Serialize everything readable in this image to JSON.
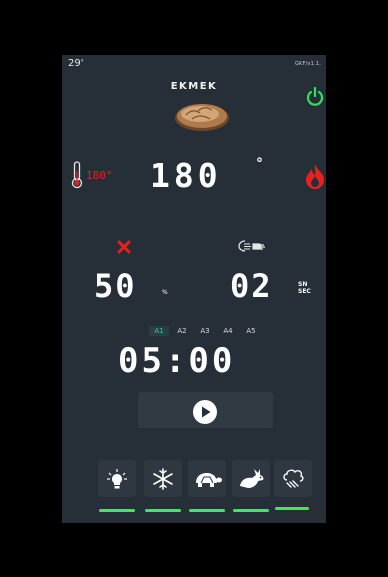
{
  "status": {
    "time": "29'",
    "version": "GKF/v1.1."
  },
  "recipe": {
    "name": "EKMEK",
    "image": "bread-image"
  },
  "temperature": {
    "setpoint": "180°",
    "value": "180",
    "unit": "°"
  },
  "humidity": {
    "value": "50",
    "unit": "%"
  },
  "fan": {
    "value": "02",
    "unit_top": "SN",
    "unit_bottom": "SEC"
  },
  "phases": {
    "items": [
      {
        "label": "A1",
        "active": true
      },
      {
        "label": "A2",
        "active": false
      },
      {
        "label": "A3",
        "active": false
      },
      {
        "label": "A4",
        "active": false
      },
      {
        "label": "A5",
        "active": false
      }
    ]
  },
  "timer": {
    "value": "05:00"
  },
  "functions": {
    "items": [
      {
        "name": "lamp",
        "icon": "lamp-icon",
        "state": "on"
      },
      {
        "name": "cool",
        "icon": "snowflake-icon",
        "state": "on"
      },
      {
        "name": "slow",
        "icon": "turtle-icon",
        "state": "on"
      },
      {
        "name": "fast",
        "icon": "rabbit-icon",
        "state": "on"
      },
      {
        "name": "steam",
        "icon": "steam-icon",
        "state": "on"
      }
    ]
  },
  "colors": {
    "accent_green": "#3ee85f",
    "alert_red": "#e8201f",
    "background": "#262f37"
  }
}
